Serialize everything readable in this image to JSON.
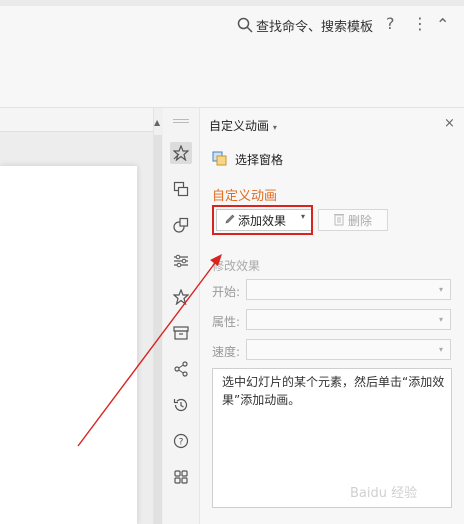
{
  "toolbar": {
    "search_label": "查找命令、搜索模板",
    "help_glyph": "?",
    "more_glyph": "⋮",
    "collapse_glyph": "⌃"
  },
  "pane": {
    "title": "自定义动画",
    "title_caret": "▾",
    "close_glyph": "×",
    "selection_pane_label": "选择窗格",
    "section_title": "自定义动画",
    "add_effect_label": "添加效果",
    "add_effect_caret": "▾",
    "delete_label": "删除",
    "modify_title": "修改效果",
    "fields": [
      {
        "label": "开始:",
        "value": ""
      },
      {
        "label": "属性:",
        "value": ""
      },
      {
        "label": "速度:",
        "value": ""
      }
    ],
    "hint_text": "选中幻灯片的某个元素，然后单击“添加效果”添加动画。"
  },
  "side_icons": [
    "animation-icon",
    "switch-icon",
    "shapes-icon",
    "settings-sliders-icon",
    "star-icon",
    "archive-icon",
    "share-icon",
    "history-icon",
    "help-circle-icon",
    "apps-grid-icon"
  ],
  "watermark": "Baidu 经验",
  "colors": {
    "accent": "#e06b1f",
    "highlight": "#d9231f"
  }
}
